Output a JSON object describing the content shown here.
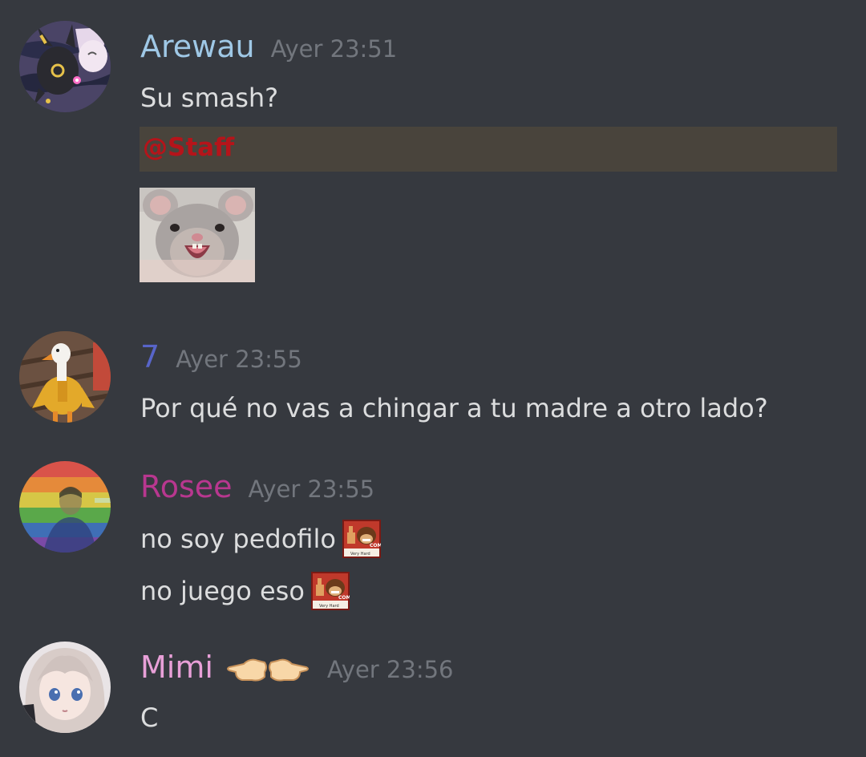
{
  "messages": [
    {
      "username": "Arewau",
      "username_color": "#9fc8e6",
      "timestamp": "Ayer 23:51",
      "lines": [
        "Su smash?"
      ],
      "mention": "@Staff",
      "mention_color": "#b5141a",
      "attachment": "rat-image"
    },
    {
      "username": "7",
      "username_color": "#5865c9",
      "timestamp": "Ayer 23:55",
      "lines": [
        "Por qué no vas a chingar a tu madre a otro lado?"
      ]
    },
    {
      "username": "Rosee",
      "username_color": "#b8378f",
      "timestamp": "Ayer 23:55",
      "lines": [
        "no soy pedofilo",
        "no juego eso"
      ],
      "line_emoji": "donkey-kong-thumbs-up-emoji",
      "emoji_caption": "Very Hard"
    },
    {
      "username": "Mimi",
      "username_color": "#e8a0d8",
      "username_emoji": "pointing-hands-emoji",
      "timestamp": "Ayer 23:56",
      "lines": [
        "C"
      ]
    }
  ],
  "colors": {
    "background": "#36393f",
    "text": "#dcddde",
    "timestamp": "#72767d",
    "mention_background": "#49443c"
  }
}
